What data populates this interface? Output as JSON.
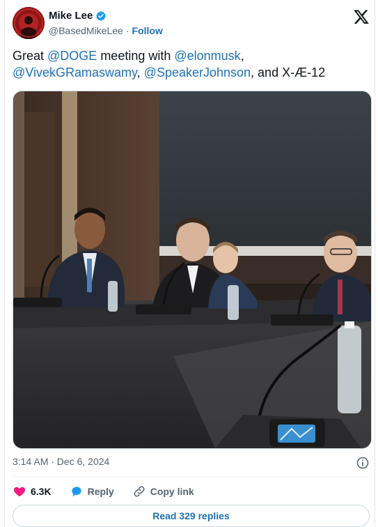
{
  "author": {
    "name": "Mike Lee",
    "handle": "@BasedMikeLee",
    "separator": "·",
    "follow_label": "Follow"
  },
  "tweet": {
    "parts": [
      {
        "text": "Great ",
        "mention": false
      },
      {
        "text": "@DOGE",
        "mention": true
      },
      {
        "text": " meeting with ",
        "mention": false
      },
      {
        "text": "@elonmusk",
        "mention": true
      },
      {
        "text": ", ",
        "mention": false
      },
      {
        "text": "@VivekGRamaswamy",
        "mention": true
      },
      {
        "text": ", ",
        "mention": false
      },
      {
        "text": "@SpeakerJohnson",
        "mention": true
      },
      {
        "text": ", and X-Æ-12",
        "mention": false
      }
    ]
  },
  "timestamp": "3:14 AM · Dec 6, 2024",
  "actions": {
    "like_count": "6.3K",
    "reply_label": "Reply",
    "copy_label": "Copy link"
  },
  "read_replies_label": "Read 329 replies",
  "colors": {
    "link": "#1d70b8",
    "like": "#f91880",
    "verified": "#1d9bf0",
    "muted": "#536471"
  },
  "icons": [
    "verified-badge-icon",
    "x-logo-icon",
    "info-icon",
    "heart-icon",
    "reply-bubble-icon",
    "link-icon"
  ]
}
